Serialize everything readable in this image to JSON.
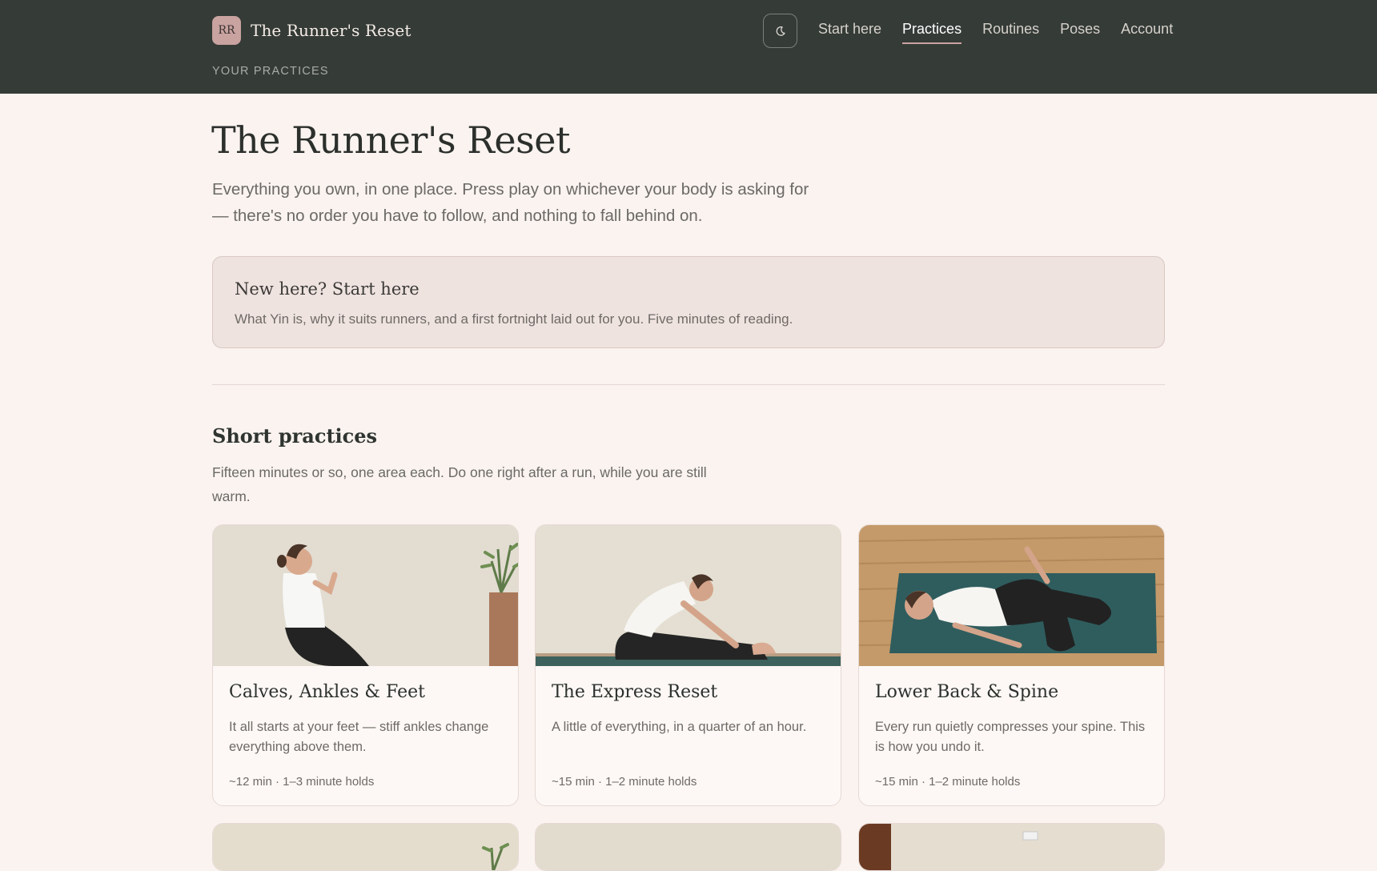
{
  "header": {
    "logo_initials": "RR",
    "brand": "The Runner's Reset",
    "theme_toggle_icon": "moon-icon",
    "nav": [
      {
        "label": "Start here",
        "active": false
      },
      {
        "label": "Practices",
        "active": true
      },
      {
        "label": "Routines",
        "active": false
      },
      {
        "label": "Poses",
        "active": false
      },
      {
        "label": "Account",
        "active": false
      }
    ],
    "subnav": "YOUR PRACTICES"
  },
  "page": {
    "title": "The Runner's Reset",
    "intro": "Everything you own, in one place. Press play on whichever your body is asking for — there's no order you have to follow, and nothing to fall behind on."
  },
  "callout": {
    "title": "New here? Start here",
    "text": "What Yin is, why it suits runners, and a first fortnight laid out for you. Five minutes of reading."
  },
  "section": {
    "title": "Short practices",
    "description": "Fifteen minutes or so, one area each. Do one right after a run, while you are still warm."
  },
  "cards": [
    {
      "title": "Calves, Ankles & Feet",
      "description": "It all starts at your feet — stiff ankles change everything above them.",
      "meta": "~12 min · 1–3 minute holds"
    },
    {
      "title": "The Express Reset",
      "description": "A little of everything, in a quarter of an hour.",
      "meta": "~15 min · 1–2 minute holds"
    },
    {
      "title": "Lower Back & Spine",
      "description": "Every run quietly compresses your spine. This is how you undo it.",
      "meta": "~15 min · 1–2 minute holds"
    }
  ],
  "colors": {
    "header_bg": "#353b37",
    "page_bg": "#faf3ef",
    "accent": "#c9a3a0",
    "callout_bg": "#efe3df"
  }
}
